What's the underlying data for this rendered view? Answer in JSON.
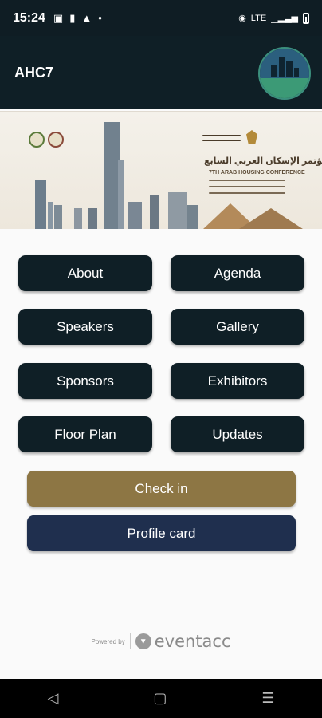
{
  "status": {
    "time": "15:24",
    "network": "LTE"
  },
  "app": {
    "title": "AHC7"
  },
  "banner": {
    "arabic_title": "مؤتمر الإسكان العربي السابع",
    "english_title": "7TH ARAB HOUSING CONFERENCE"
  },
  "menu": [
    {
      "label": "About"
    },
    {
      "label": "Agenda"
    },
    {
      "label": "Speakers"
    },
    {
      "label": "Gallery"
    },
    {
      "label": "Sponsors"
    },
    {
      "label": "Exhibitors"
    },
    {
      "label": "Floor Plan"
    },
    {
      "label": "Updates"
    }
  ],
  "actions": {
    "checkin": "Check in",
    "profile": "Profile card"
  },
  "footer": {
    "powered_by": "Powered by",
    "brand": "eventacc"
  },
  "colors": {
    "primary": "#0f1f26",
    "checkin": "#8d7644",
    "profile": "#1f2f4e"
  },
  "icons": [
    "message-icon",
    "battery-alert-icon",
    "warning-icon",
    "dot-icon",
    "vibrate-icon",
    "signal-icon",
    "battery-icon",
    "back-icon",
    "home-icon",
    "recents-icon"
  ]
}
